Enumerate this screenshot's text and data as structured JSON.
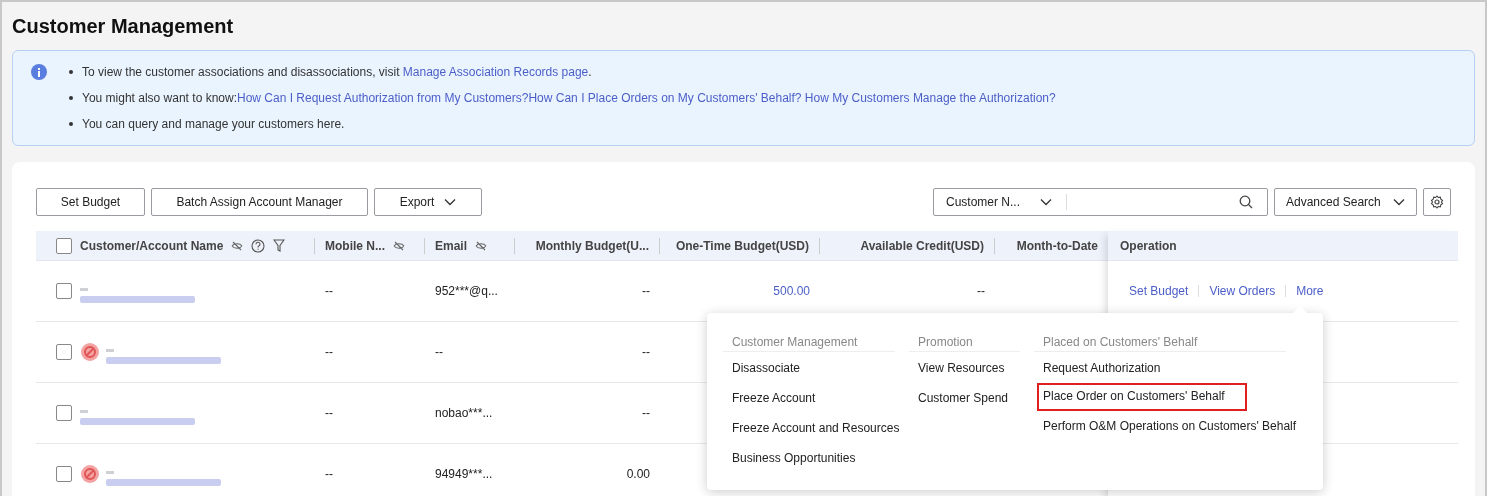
{
  "page": {
    "title": "Customer Management"
  },
  "notice": {
    "items": [
      {
        "text": "To view the customer associations and disassociations, visit ",
        "links": [
          "Manage Association Records page"
        ],
        "after": "."
      },
      {
        "text": "You might also want to know:",
        "links": [
          "How Can I Request Authorization from My Customers?",
          "How Can I Place Orders on My Customers' Behalf?",
          "How My Customers Manage the Authorization?"
        ]
      },
      {
        "text": "You can query and manage your customers here."
      }
    ]
  },
  "toolbar": {
    "buttons": [
      {
        "label": "Set Budget",
        "kind": "button"
      },
      {
        "label": "Batch Assign Account Manager",
        "kind": "button"
      },
      {
        "label": "Export",
        "kind": "dropdown"
      }
    ],
    "search_type": "Customer N...",
    "advanced_search": "Advanced Search"
  },
  "table": {
    "select_all_checked": false,
    "name_column": "Customer/Account Name",
    "columns": [
      "Mobile N...",
      "Email",
      "Monthly Budget(U...",
      "One-Time Budget(USD)",
      "Available Credit(USD)",
      "Month-to-Date"
    ],
    "operation_column": "Operation",
    "rows": [
      {
        "checked": false,
        "warning": false,
        "cells": [
          "--",
          "952***@q...",
          "--",
          "500.00",
          "--"
        ],
        "operations": [
          "Set Budget",
          "View Orders",
          "More"
        ]
      },
      {
        "checked": false,
        "warning": true,
        "cells": [
          "--",
          "--",
          "--"
        ],
        "operations": []
      },
      {
        "checked": false,
        "warning": false,
        "cells": [
          "--",
          "nobao***...",
          "--"
        ],
        "operations": []
      },
      {
        "checked": false,
        "warning": true,
        "cells": [
          "--",
          "94949***...",
          "0.00"
        ],
        "operations": []
      }
    ]
  },
  "more_menu": {
    "groups": [
      {
        "title": "Customer Management",
        "items": [
          {
            "label": "Disassociate",
            "highlighted": false
          },
          {
            "label": "Freeze Account",
            "highlighted": false
          },
          {
            "label": "Freeze Account and Resources",
            "highlighted": false
          },
          {
            "label": "Business Opportunities",
            "highlighted": false
          }
        ]
      },
      {
        "title": "Promotion",
        "items": [
          {
            "label": "View Resources",
            "highlighted": false
          },
          {
            "label": "Customer Spend",
            "highlighted": false
          }
        ]
      },
      {
        "title": "Placed on Customers' Behalf",
        "items": [
          {
            "label": "Request Authorization",
            "highlighted": false
          },
          {
            "label": "Place Order on Customers' Behalf",
            "highlighted": true
          },
          {
            "label": "Perform O&M Operations on Customers' Behalf",
            "highlighted": false
          }
        ]
      }
    ]
  }
}
